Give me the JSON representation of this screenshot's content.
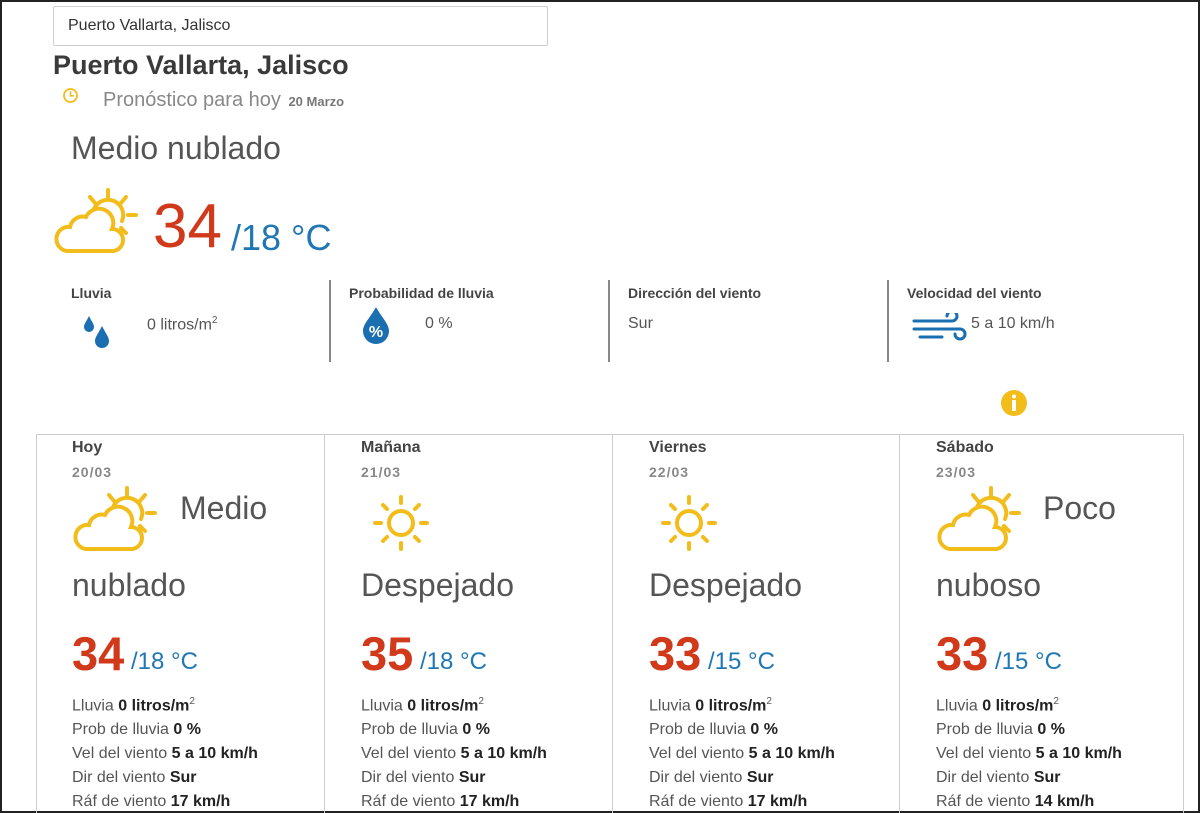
{
  "search": {
    "value": "Puerto Vallarta, Jalisco"
  },
  "location": {
    "title": "Puerto Vallarta, Jalisco"
  },
  "today": {
    "forecast_label": "Pronóstico para hoy",
    "date": "20 Marzo",
    "condition": "Medio nublado",
    "temp_max": "34",
    "temp_min": "/18 °C",
    "icon": "partly-cloudy-icon"
  },
  "details": [
    {
      "label": "Lluvia",
      "value": "0 litros/m",
      "sup": "2",
      "icon": "raindrops-icon"
    },
    {
      "label": "Probabilidad de lluvia",
      "value": "0 %",
      "icon": "rain-probability-icon"
    },
    {
      "label": "Dirección del viento",
      "value": "Sur"
    },
    {
      "label": "Velocidad del viento",
      "value": "5 a 10 km/h",
      "icon": "wind-icon"
    }
  ],
  "days": [
    {
      "name": "Hoy",
      "date": "20/03",
      "cond_line1": "Medio",
      "cond_line2": "nublado",
      "temp_max": "34",
      "temp_min": "/18 °C",
      "icon": "partly-cloudy-icon",
      "rain_label": "Lluvia",
      "rain": "0 litros/m",
      "rain_sup": "2",
      "prob_label": "Prob de lluvia",
      "prob": "0 %",
      "wind_label": "Vel del viento",
      "wind": "5 a 10 km/h",
      "dir_label": "Dir del viento",
      "dir": "Sur",
      "gust_label": "Ráf de viento",
      "gust": "17 km/h"
    },
    {
      "name": "Mañana",
      "date": "21/03",
      "cond_line1": "",
      "cond_line2": "Despejado",
      "temp_max": "35",
      "temp_min": "/18 °C",
      "icon": "sun-icon",
      "rain_label": "Lluvia",
      "rain": "0 litros/m",
      "rain_sup": "2",
      "prob_label": "Prob de lluvia",
      "prob": "0 %",
      "wind_label": "Vel del viento",
      "wind": "5 a 10 km/h",
      "dir_label": "Dir del viento",
      "dir": "Sur",
      "gust_label": "Ráf de viento",
      "gust": "17 km/h"
    },
    {
      "name": "Viernes",
      "date": "22/03",
      "cond_line1": "",
      "cond_line2": "Despejado",
      "temp_max": "33",
      "temp_min": "/15 °C",
      "icon": "sun-icon",
      "rain_label": "Lluvia",
      "rain": "0 litros/m",
      "rain_sup": "2",
      "prob_label": "Prob de lluvia",
      "prob": "0 %",
      "wind_label": "Vel del viento",
      "wind": "5 a 10 km/h",
      "dir_label": "Dir del viento",
      "dir": "Sur",
      "gust_label": "Ráf de viento",
      "gust": "17 km/h"
    },
    {
      "name": "Sábado",
      "date": "23/03",
      "cond_line1": "Poco",
      "cond_line2": "nuboso",
      "temp_max": "33",
      "temp_min": "/15 °C",
      "icon": "partly-cloudy-icon",
      "rain_label": "Lluvia",
      "rain": "0 litros/m",
      "rain_sup": "2",
      "prob_label": "Prob de lluvia",
      "prob": "0 %",
      "wind_label": "Vel del viento",
      "wind": "5 a 10 km/h",
      "dir_label": "Dir del viento",
      "dir": "Sur",
      "gust_label": "Ráf de viento",
      "gust": "14 km/h"
    }
  ],
  "colors": {
    "max_temp": "#d0391a",
    "min_temp": "#1f77b4",
    "icon_yellow": "#f2bd1b",
    "icon_blue": "#1a6fb0"
  }
}
